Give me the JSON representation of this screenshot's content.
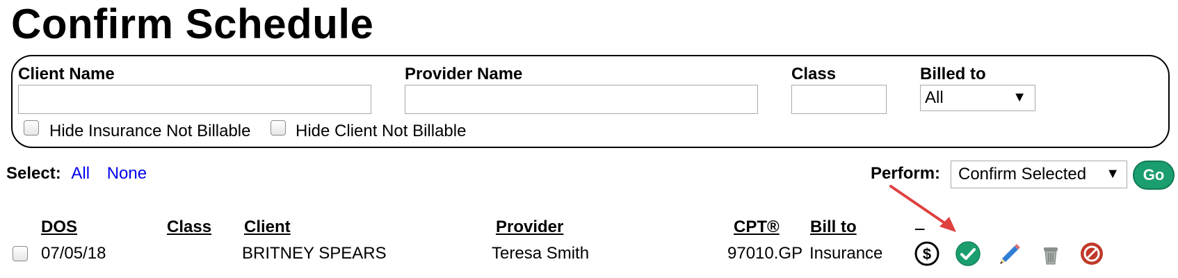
{
  "page_title": "Confirm Schedule",
  "filters": {
    "client_name_label": "Client Name",
    "client_name_value": "",
    "provider_name_label": "Provider Name",
    "provider_name_value": "",
    "class_label": "Class",
    "class_value": "",
    "billed_to_label": "Billed to",
    "billed_to_value": "All",
    "hide_insurance_label": "Hide Insurance Not Billable",
    "hide_client_label": "Hide Client Not Billable"
  },
  "select": {
    "label": "Select:",
    "all": "All",
    "none": "None"
  },
  "perform": {
    "label": "Perform:",
    "value": "Confirm Selected",
    "go": "Go"
  },
  "table": {
    "headers": {
      "dos": "DOS",
      "class": "Class",
      "client": "Client",
      "provider": "Provider",
      "cpt": "CPT®",
      "bill_to": "Bill to",
      "actions": "_"
    },
    "rows": [
      {
        "dos": "07/05/18",
        "class": "",
        "client": "BRITNEY SPEARS",
        "provider": "Teresa Smith",
        "cpt": "97010.GP",
        "bill_to": "Insurance"
      }
    ]
  },
  "icons": [
    "dollar-icon",
    "confirm-check-icon",
    "edit-pencil-icon",
    "trash-icon",
    "cancel-icon"
  ],
  "colors": {
    "go_button": "#1a9e6e",
    "link": "#0000ee",
    "check_icon": "#1a9e6e",
    "cancel_icon": "#c0392b",
    "annotation_arrow": "#e04040"
  }
}
